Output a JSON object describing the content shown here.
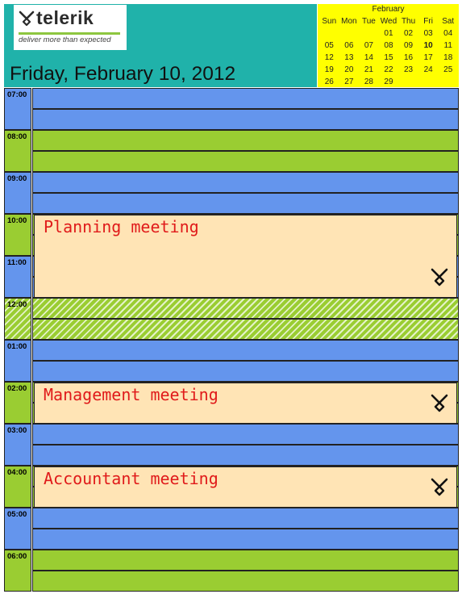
{
  "brand": {
    "name": "telerik",
    "tagline": "deliver more than expected",
    "logo_icon": "telerik-logo-icon"
  },
  "date_title": "Friday, February 10, 2012",
  "calendar": {
    "month": "February",
    "weekdays": [
      "Sun",
      "Mon",
      "Tue",
      "Wed",
      "Thu",
      "Fri",
      "Sat"
    ],
    "weeks": [
      [
        "",
        "",
        "",
        "01",
        "02",
        "03",
        "04"
      ],
      [
        "05",
        "06",
        "07",
        "08",
        "09",
        "10",
        "11"
      ],
      [
        "12",
        "13",
        "14",
        "15",
        "16",
        "17",
        "18"
      ],
      [
        "19",
        "20",
        "21",
        "22",
        "23",
        "24",
        "25"
      ],
      [
        "26",
        "27",
        "28",
        "29",
        "",
        "",
        ""
      ]
    ],
    "selected_day": "10"
  },
  "schedule": {
    "colors": {
      "blue": "#6495ed",
      "green": "#9acd32",
      "appointment_fill": "#ffe4b5",
      "appointment_text": "#e01a1a"
    },
    "hours": [
      {
        "label": "07:00",
        "color": "blue"
      },
      {
        "label": "08:00",
        "color": "green"
      },
      {
        "label": "09:00",
        "color": "blue"
      },
      {
        "label": "10:00",
        "color": "green"
      },
      {
        "label": "11:00",
        "color": "blue"
      },
      {
        "label": "12:00",
        "color": "hatched-green"
      },
      {
        "label": "01:00",
        "color": "blue"
      },
      {
        "label": "02:00",
        "color": "green"
      },
      {
        "label": "03:00",
        "color": "blue"
      },
      {
        "label": "04:00",
        "color": "green"
      },
      {
        "label": "05:00",
        "color": "blue"
      },
      {
        "label": "06:00",
        "color": "green"
      }
    ],
    "appointments": [
      {
        "title": "Planning meeting",
        "start": "10:00",
        "end": "12:00",
        "icon": "telerik-logo-icon"
      },
      {
        "title": "Management meeting",
        "start": "02:00",
        "end": "03:00",
        "icon": "telerik-logo-icon"
      },
      {
        "title": "Accountant meeting",
        "start": "04:00",
        "end": "05:00",
        "icon": "telerik-logo-icon"
      }
    ]
  }
}
